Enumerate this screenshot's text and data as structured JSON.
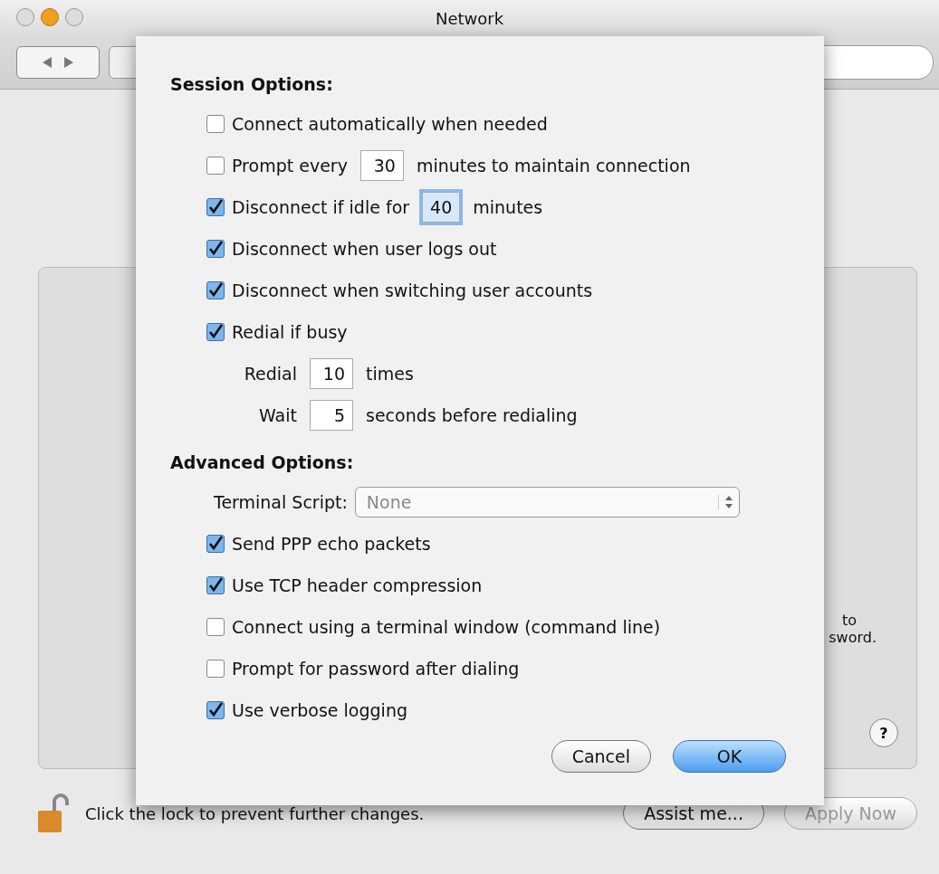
{
  "window": {
    "title": "Network"
  },
  "panel": {
    "partial_text": [
      "to",
      "sword."
    ],
    "help": "?"
  },
  "sheet": {
    "sections": [
      {
        "title": "Session Options:",
        "rows": [
          {
            "kind": "checkbox",
            "label": "Connect automatically when needed",
            "checked": false
          },
          {
            "kind": "checkbox",
            "label": "Prompt every",
            "checked": false,
            "field": {
              "value": "30",
              "focused": false
            },
            "suffix": "minutes to maintain connection"
          },
          {
            "kind": "checkbox",
            "label": "Disconnect if idle for",
            "checked": true,
            "field": {
              "value": "40",
              "focused": true
            },
            "suffix": "minutes"
          },
          {
            "kind": "checkbox",
            "label": "Disconnect when user logs out",
            "checked": true
          },
          {
            "kind": "checkbox",
            "label": "Disconnect when switching user accounts",
            "checked": true
          },
          {
            "kind": "checkbox",
            "label": "Redial if busy",
            "checked": true
          },
          {
            "kind": "field",
            "label": "Redial",
            "field": {
              "value": "10",
              "focused": false
            },
            "suffix": "times"
          },
          {
            "kind": "field",
            "label": "Wait",
            "field": {
              "value": "5",
              "focused": false
            },
            "suffix": "seconds before redialing"
          }
        ]
      },
      {
        "title": "Advanced Options:",
        "rows": [
          {
            "kind": "popup",
            "label": "Terminal Script:",
            "value": "None",
            "disabled": true
          },
          {
            "kind": "checkbox",
            "label": "Send PPP echo packets",
            "checked": true
          },
          {
            "kind": "checkbox",
            "label": "Use TCP header compression",
            "checked": true
          },
          {
            "kind": "checkbox",
            "label": "Connect using a terminal window (command line)",
            "checked": false
          },
          {
            "kind": "checkbox",
            "label": "Prompt for password after dialing",
            "checked": false
          },
          {
            "kind": "checkbox",
            "label": "Use verbose logging",
            "checked": true
          }
        ]
      }
    ],
    "buttons": [
      {
        "label": "Cancel",
        "default": false
      },
      {
        "label": "OK",
        "default": true
      }
    ]
  },
  "footer": {
    "lock_text": "Click the lock to prevent further changes.",
    "buttons": [
      {
        "label": "Assist me...",
        "disabled": false
      },
      {
        "label": "Apply Now",
        "disabled": true
      }
    ]
  }
}
